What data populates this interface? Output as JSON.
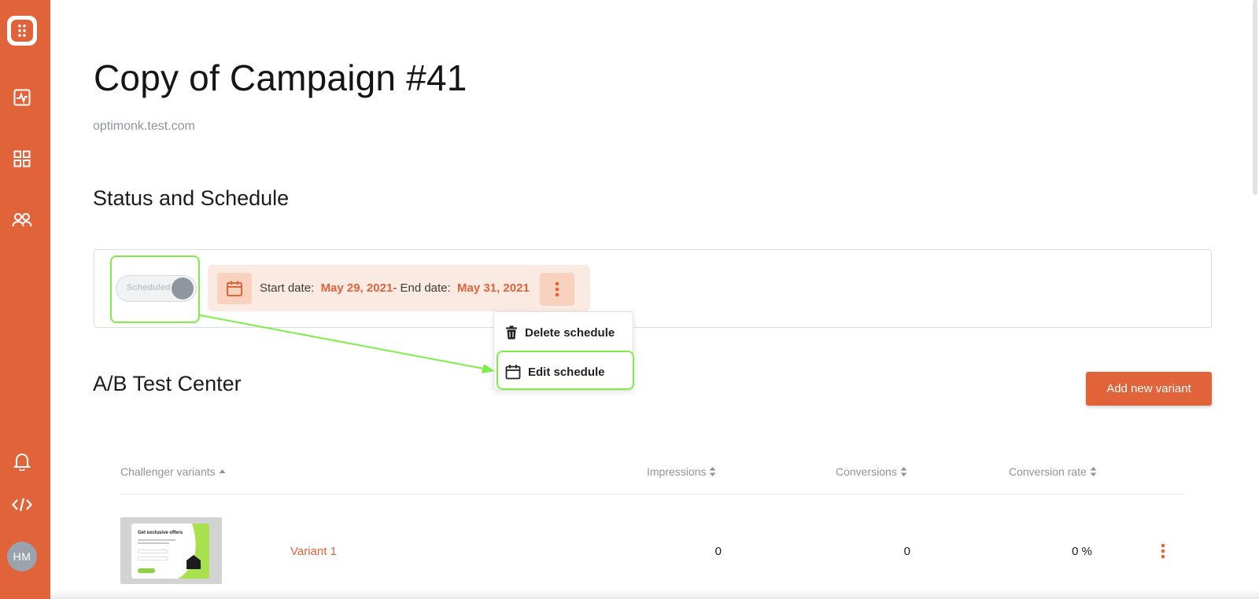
{
  "sidebar": {
    "avatar_initials": "HM",
    "icons": [
      "app-logo-icon",
      "activity-chart-icon",
      "grid-icon",
      "users-icon",
      "bell-icon",
      "code-icon"
    ]
  },
  "header": {
    "title": "Copy of Campaign #41",
    "domain": "optimonk.test.com"
  },
  "status_section": {
    "title": "Status and Schedule",
    "toggle_label": "Scheduled",
    "start_label": "Start date:",
    "start_date": "May 29, 2021",
    "end_label": "- End date:",
    "end_date": "May 31, 2021"
  },
  "schedule_menu": {
    "items": [
      {
        "label": "Delete schedule",
        "icon": "trash-icon"
      },
      {
        "label": "Edit schedule",
        "icon": "calendar-icon"
      }
    ]
  },
  "ab_section": {
    "title": "A/B Test Center",
    "add_button": "Add new variant",
    "columns": [
      "Challenger variants",
      "Impressions",
      "Conversions",
      "Conversion rate"
    ],
    "rows": [
      {
        "name": "Variant 1",
        "thumb_heading": "Get exclusive offers",
        "impressions": "0",
        "conversions": "0",
        "conversion_rate": "0 %"
      }
    ]
  },
  "colors": {
    "brand": "#e0633a",
    "highlight": "#7ded4a",
    "chip_bg": "#fbeae2"
  }
}
